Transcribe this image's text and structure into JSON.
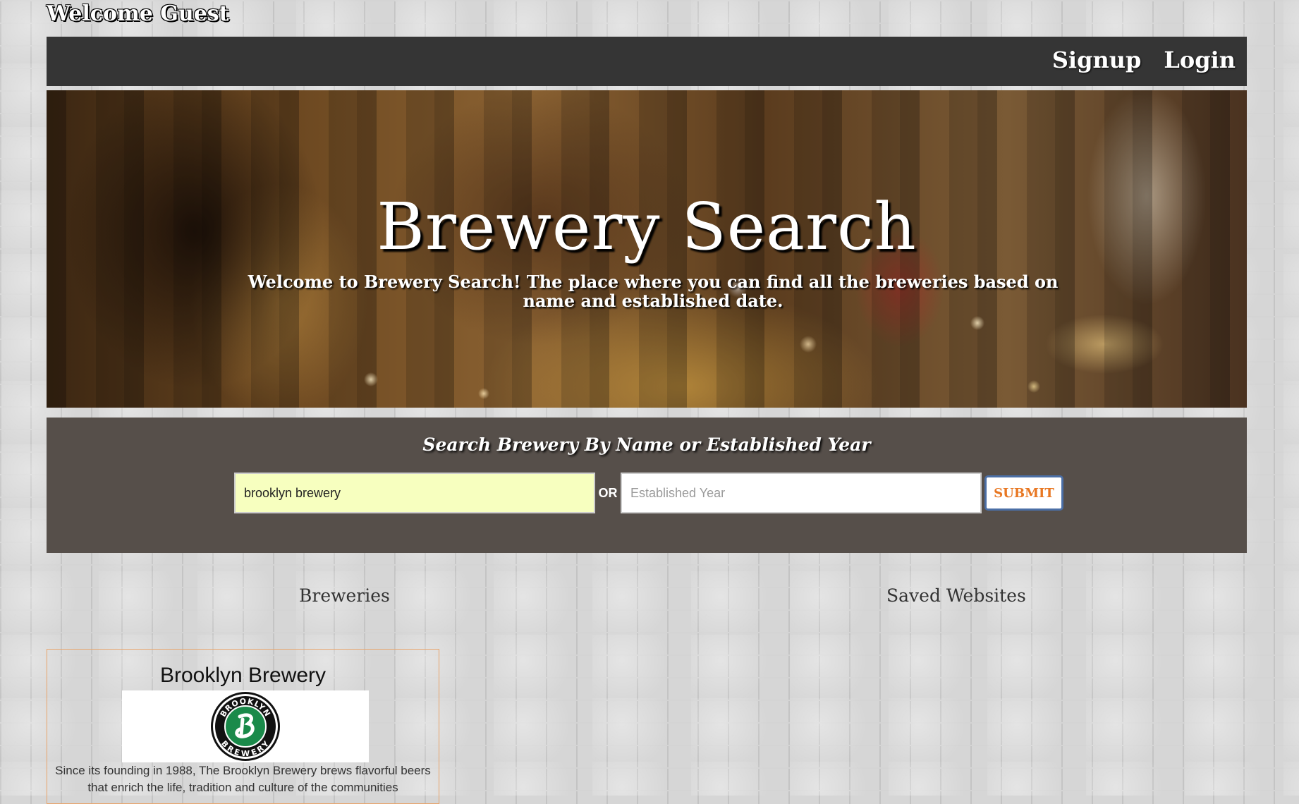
{
  "header": {
    "welcome_text": "Welcome Guest"
  },
  "nav": {
    "signup": "Signup",
    "login": "Login"
  },
  "hero": {
    "title": "Brewery Search",
    "subtitle": "Welcome to Brewery Search! The place where you can find all the breweries based on name and established date."
  },
  "search": {
    "heading": "Search Brewery By Name or Established Year",
    "name_value": "brooklyn brewery",
    "or_label": "OR",
    "year_placeholder": "Established Year",
    "submit_label": "SUBMIT"
  },
  "columns": {
    "breweries": "Breweries",
    "saved": "Saved Websites"
  },
  "results": [
    {
      "name": "Brooklyn Brewery",
      "logo_top_text": "BROOKLYN",
      "logo_bottom_text": "BREWERY",
      "description": "Since its founding in 1988, The Brooklyn Brewery brews flavorful beers that enrich the life, tradition and culture of the communities"
    }
  ],
  "colors": {
    "navbar": "#353535",
    "search_panel": "#564f4a",
    "name_input_bg": "#f7ffbf",
    "submit_text": "#e87722",
    "submit_border": "#4b6fa6",
    "card_border": "#e8a46b",
    "logo_green": "#1a8a4a"
  }
}
